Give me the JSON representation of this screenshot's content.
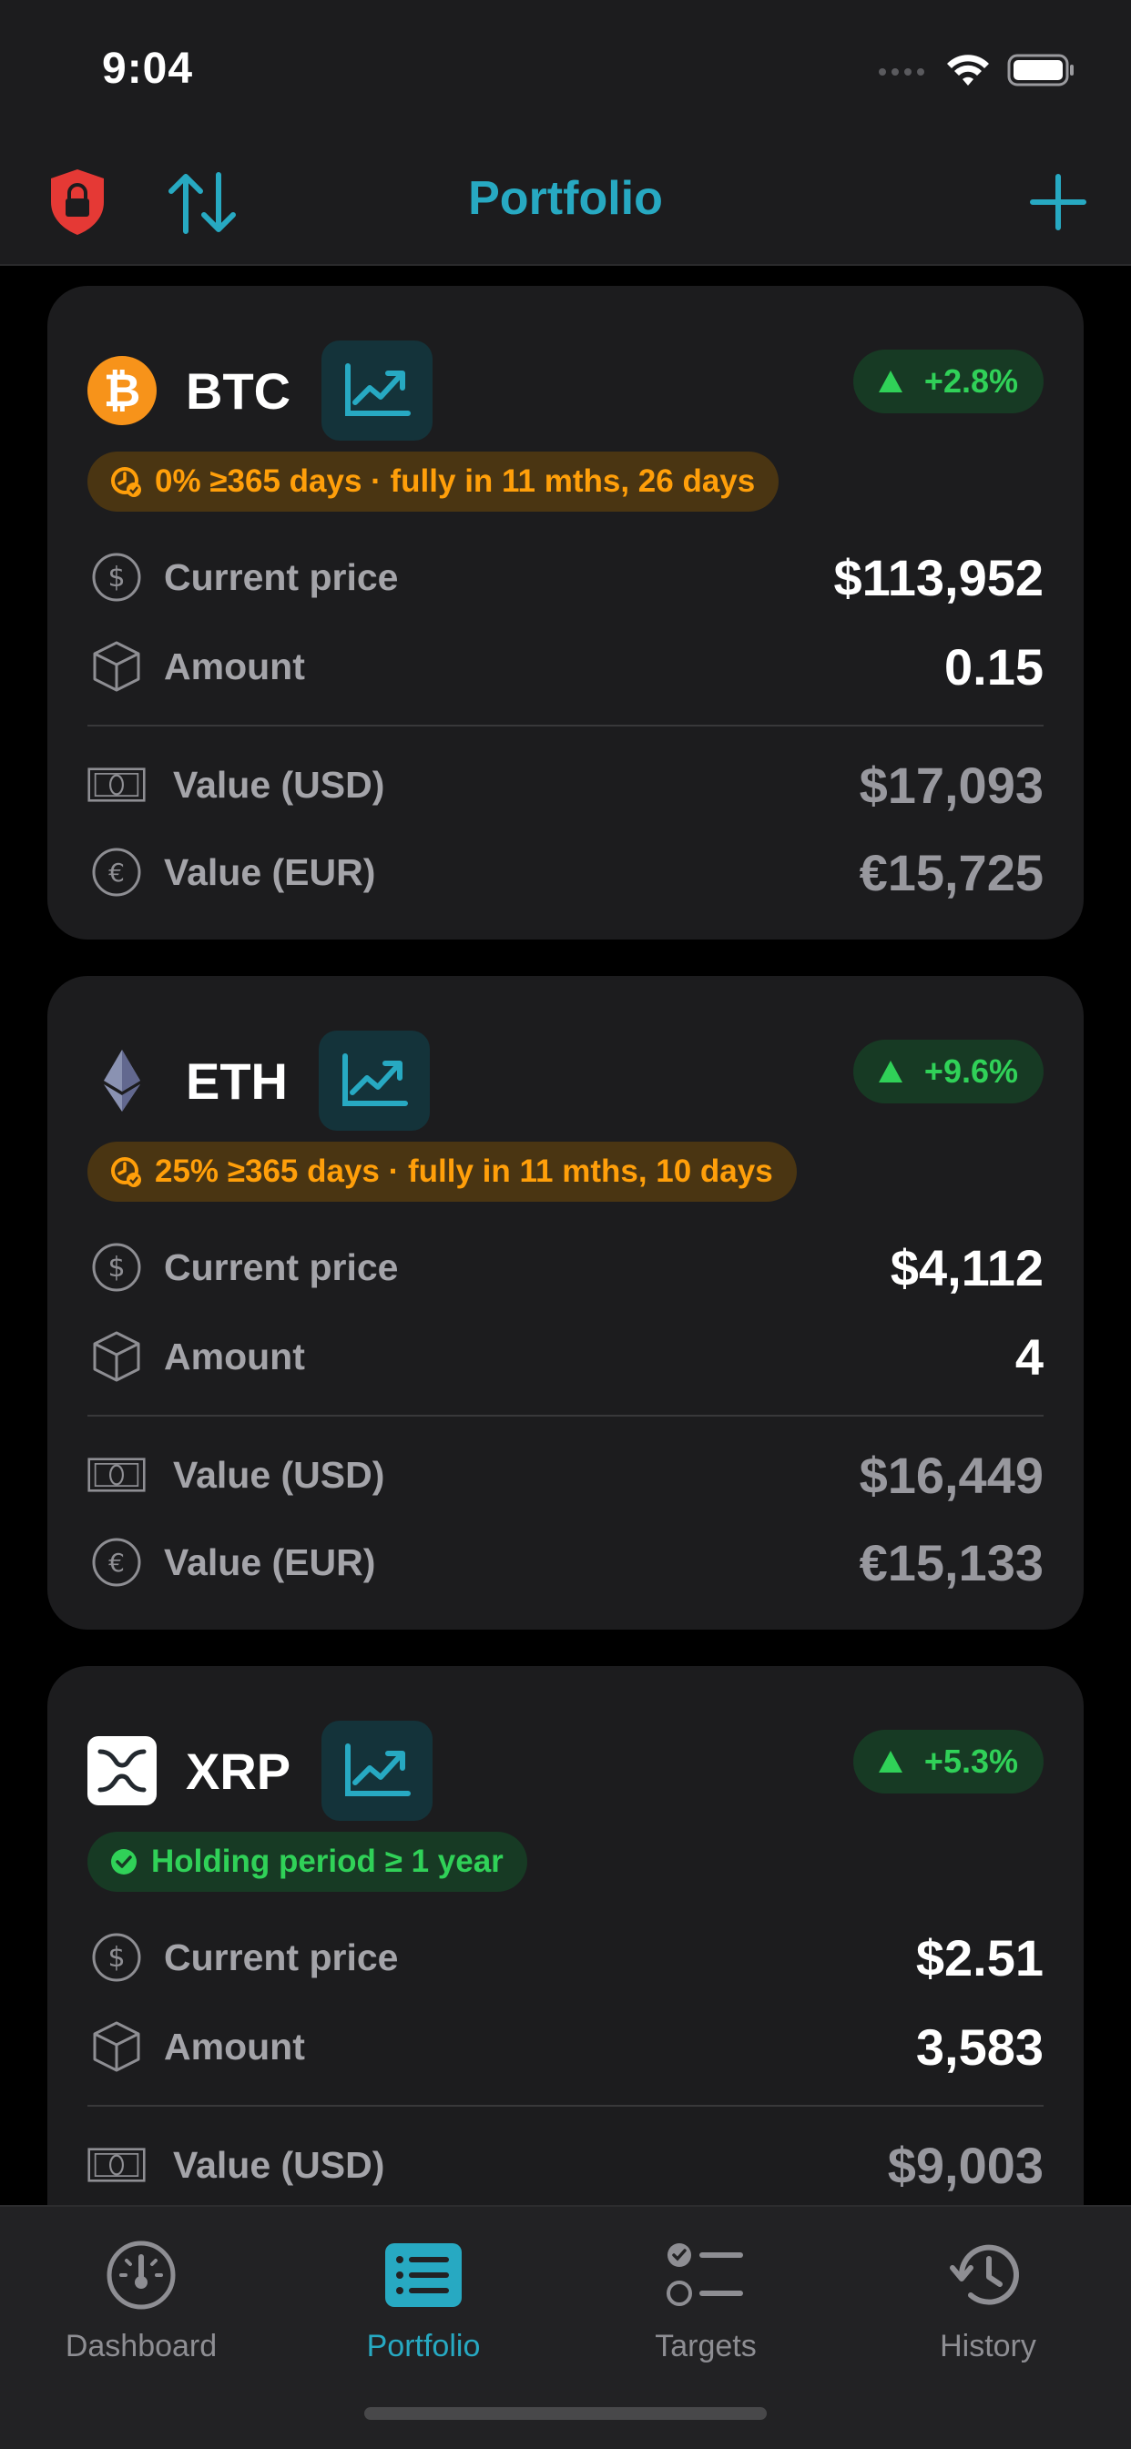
{
  "status": {
    "time": "9:04"
  },
  "nav": {
    "title": "Portfolio",
    "icons": [
      "lock-shield-icon",
      "sort-arrows-icon",
      "plus-icon"
    ]
  },
  "coins": [
    {
      "symbol": "BTC",
      "logo_color": "#f7931a",
      "change": "+2.8%",
      "holding": "0% ≥365 days · fully in  11 mths, 26 days",
      "holding_status": "pending",
      "rows": [
        {
          "label": "Current price",
          "value": "$113,952"
        },
        {
          "label": "Amount",
          "value": "0.15"
        },
        {
          "label": "Value (USD)",
          "value": "$17,093"
        },
        {
          "label": "Value (EUR)",
          "value": "€15,725"
        }
      ]
    },
    {
      "symbol": "ETH",
      "logo_color": "#627eea",
      "change": "+9.6%",
      "holding": "25% ≥365 days · fully in  11 mths, 10 days",
      "holding_status": "pending",
      "rows": [
        {
          "label": "Current price",
          "value": "$4,112"
        },
        {
          "label": "Amount",
          "value": "4"
        },
        {
          "label": "Value (USD)",
          "value": "$16,449"
        },
        {
          "label": "Value (EUR)",
          "value": "€15,133"
        }
      ]
    },
    {
      "symbol": "XRP",
      "logo_color": "#ffffff",
      "change": "+5.3%",
      "holding": "Holding period ≥ 1 year",
      "holding_status": "complete",
      "rows": [
        {
          "label": "Current price",
          "value": "$2.51"
        },
        {
          "label": "Amount",
          "value": "3,583"
        },
        {
          "label": "Value (USD)",
          "value": "$9,003"
        }
      ]
    }
  ],
  "tabs": [
    {
      "label": "Dashboard",
      "icon": "gauge-icon",
      "active": false
    },
    {
      "label": "Portfolio",
      "icon": "list-icon",
      "active": true
    },
    {
      "label": "Targets",
      "icon": "checklist-icon",
      "active": false
    },
    {
      "label": "History",
      "icon": "clock-history-icon",
      "active": false
    }
  ],
  "colors": {
    "accent": "#27a9c2",
    "positive": "#30d158",
    "warning": "#ff9f0a",
    "lock": "#e53935"
  }
}
